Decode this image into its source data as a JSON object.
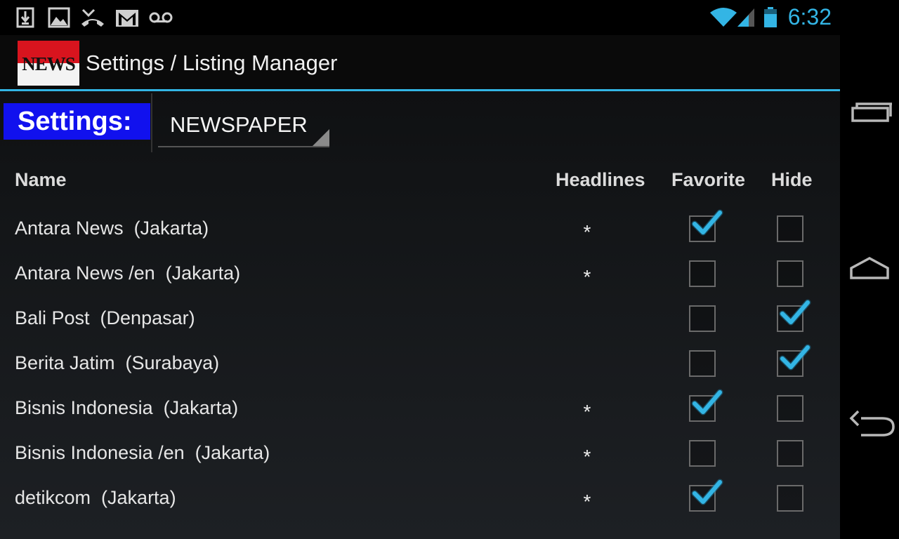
{
  "status_bar": {
    "time": "6:32",
    "left_icons": [
      "download-icon",
      "image-icon",
      "missed-call-icon",
      "gmail-icon",
      "voicemail-icon"
    ],
    "right_icons": [
      "wifi-icon",
      "signal-icon",
      "battery-icon"
    ],
    "accent": "#33b5e5"
  },
  "action_bar": {
    "logo_text": "NEWS",
    "title": "Settings / Listing Manager"
  },
  "settings": {
    "label": "Settings:",
    "spinner_value": "NEWSPAPER",
    "badge_color": "#1111ee"
  },
  "table": {
    "headers": {
      "name": "Name",
      "headlines": "Headlines",
      "favorite": "Favorite",
      "hide": "Hide"
    },
    "rows": [
      {
        "name": "Antara News  (Jakarta)",
        "headlines": "*",
        "favorite": true,
        "hide": false
      },
      {
        "name": "Antara News /en  (Jakarta)",
        "headlines": "*",
        "favorite": false,
        "hide": false
      },
      {
        "name": "Bali Post  (Denpasar)",
        "headlines": "",
        "favorite": false,
        "hide": true
      },
      {
        "name": "Berita Jatim  (Surabaya)",
        "headlines": "",
        "favorite": false,
        "hide": true
      },
      {
        "name": "Bisnis Indonesia  (Jakarta)",
        "headlines": "*",
        "favorite": true,
        "hide": false
      },
      {
        "name": "Bisnis Indonesia /en  (Jakarta)",
        "headlines": "*",
        "favorite": false,
        "hide": false
      },
      {
        "name": "detikcom  (Jakarta)",
        "headlines": "*",
        "favorite": true,
        "hide": false
      }
    ]
  },
  "nav_bar": {
    "buttons": [
      "recent-apps-icon",
      "home-icon",
      "back-icon"
    ]
  }
}
